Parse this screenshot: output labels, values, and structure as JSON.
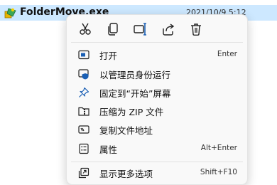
{
  "file": {
    "name": "FolderMove.exe",
    "date": "2021/10/9 5:12"
  },
  "context_menu": {
    "toolbar": [
      {
        "icon": "cut-icon"
      },
      {
        "icon": "copy-icon"
      },
      {
        "icon": "rename-icon"
      },
      {
        "icon": "share-icon"
      },
      {
        "icon": "delete-icon"
      }
    ],
    "items": [
      {
        "label": "打开",
        "shortcut": "Enter",
        "icon": "open-app-icon"
      },
      {
        "label": "以管理员身份运行",
        "shortcut": "",
        "icon": "admin-shield-icon"
      },
      {
        "label": "固定到“开始”屏幕",
        "shortcut": "",
        "icon": "pin-icon"
      },
      {
        "label": "压缩为 ZIP 文件",
        "shortcut": "",
        "icon": "zip-folder-icon"
      },
      {
        "label": "复制文件地址",
        "shortcut": "",
        "icon": "copy-path-icon"
      },
      {
        "label": "属性",
        "shortcut": "Alt+Enter",
        "icon": "properties-icon"
      },
      {
        "label": "显示更多选项",
        "shortcut": "Shift+F10",
        "icon": "more-options-icon"
      }
    ]
  }
}
